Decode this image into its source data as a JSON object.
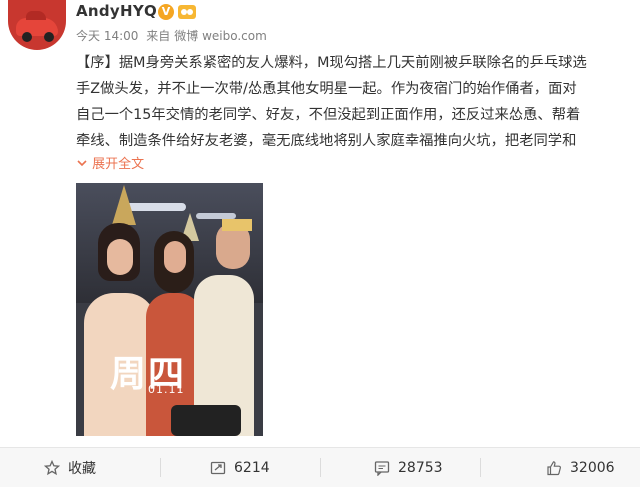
{
  "post": {
    "username": "AndyHYQ",
    "verified_badge": "V",
    "timestamp": "今天 14:00",
    "source_prefix": "来自",
    "source": "微博 weibo.com",
    "content_lines": [
      "【序】据M身旁关系紧密的友人爆料，M现勾搭上几天前刚被乒联除名的乒乓球选",
      "手Z做头发，并不止一次带/怂恿其他女明星一起。作为夜宿门的始作俑者，面对",
      "自己一个15年交情的老同学、好友，不但没起到正面作用，还反过来怂恿、帮着",
      "牵线、制造条件给好友老婆，毫无底线地将别人家庭幸福推向火坑，把老同学和"
    ],
    "expand_label": "展开全文",
    "expand_icon": "chevron-down-icon",
    "image_overlay_text": "周四",
    "image_overlay_date": "01.11"
  },
  "actions": {
    "favorite_label": "收藏",
    "repost_count": "6214",
    "comment_count": "28753",
    "like_count": "32006"
  },
  "colors": {
    "accent": "#eb7350",
    "badge": "#f5a623",
    "meta_text": "#808080"
  }
}
